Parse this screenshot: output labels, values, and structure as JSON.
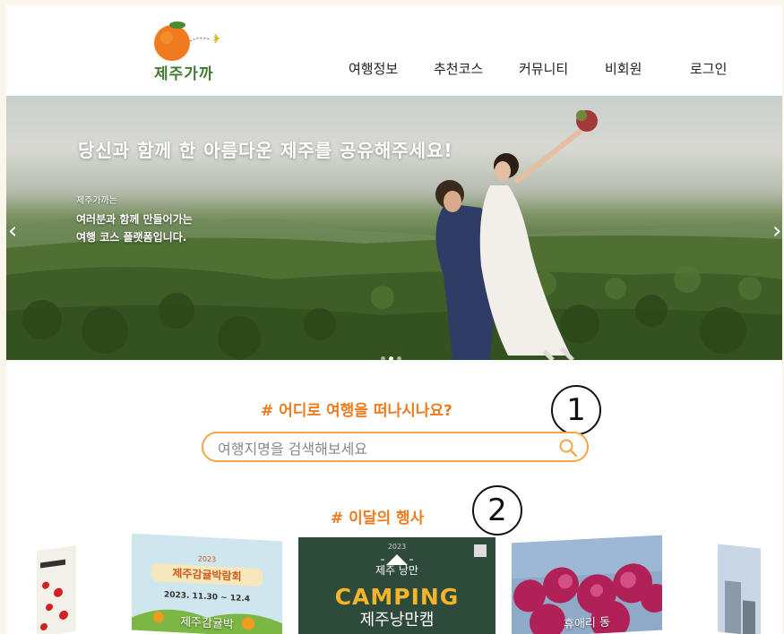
{
  "header": {
    "logo_text": "제주가까",
    "nav": [
      {
        "label": "여행정보"
      },
      {
        "label": "추천코스"
      },
      {
        "label": "커뮤니티"
      },
      {
        "label": "비회원"
      },
      {
        "label": "로그인"
      }
    ]
  },
  "hero": {
    "title": "당신과 함께 한 아름다운 제주를 공유해주세요!",
    "sub_small": "제주가까는",
    "sub_line1": "여러분과 함께 만들어가는",
    "sub_line2": "여행 코스 플랫폼입니다.",
    "prev_arrow": "‹",
    "next_arrow": "›",
    "slide_count": 3,
    "active_slide": 1
  },
  "search": {
    "title": "# 어디로 여행을 떠나시나요?",
    "placeholder": "여행지명을 검색해보세요",
    "annotation": "1"
  },
  "events": {
    "title": "# 이달의 행사",
    "annotation": "2",
    "cards": [
      {
        "caption": ""
      },
      {
        "caption": "제주감귤박",
        "poster_year": "2023",
        "poster_title": "제주감귤박람회",
        "poster_dates": "2023. 11.30 ~ 12.4"
      },
      {
        "caption": "제주낭만캠",
        "poster_year": "2023",
        "poster_label": "제주 낭만",
        "poster_title": "CAMPING"
      },
      {
        "caption": "휴애리 동"
      },
      {
        "caption": ""
      }
    ]
  },
  "colors": {
    "accent": "#f07a1e",
    "search_border": "#f5a542",
    "logo_green": "#3d7a2f",
    "page_bg": "#fbf6ec"
  }
}
